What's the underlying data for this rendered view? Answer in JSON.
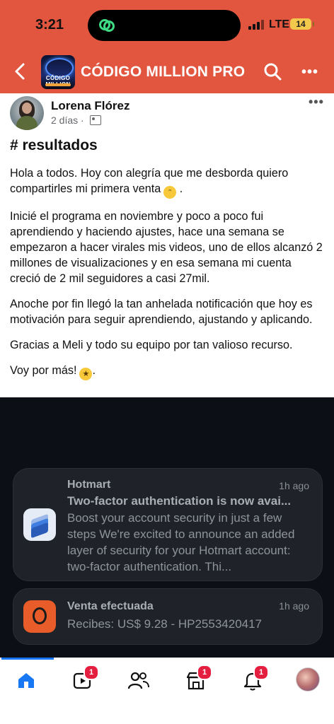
{
  "status": {
    "time": "3:21",
    "network": "LTE",
    "battery": "14"
  },
  "app_bar": {
    "title": "CÓDIGO MILLION PRO",
    "logo_text": "CÓDIGO MILLION"
  },
  "post": {
    "author": "Lorena Flórez",
    "time": "2 días",
    "separator": "·",
    "heading": "# resultados",
    "paragraphs": [
      "Hola a todos. Hoy con alegría que me desborda quiero compartirles mi primera venta",
      "Inicié el programa en noviembre y poco a poco fui aprendiendo y haciendo ajustes, hace una semana se empezaron a hacer virales mis videos, uno de ellos alcanzó 2 millones de visualizaciones y en esa semana mi cuenta creció de 2 mil seguidores a casi 27mil.",
      "Anoche por fin llegó la tan anhelada notificación que hoy es motivación para seguir aprendiendo, ajustando y aplicando.",
      "Gracias a Meli y todo su equipo por tan valioso recurso.",
      "Voy por más!"
    ],
    "emoji_end": "."
  },
  "notifications": [
    {
      "app": "Hotmart",
      "time": "1h ago",
      "title": "Two-factor authentication is now avai...",
      "body": "Boost your account security in just a few steps We're excited to announce an added layer of security for your Hotmart account: two-factor authentication. Thi..."
    },
    {
      "app": "Venta efectuada",
      "time": "1h ago",
      "body": "Recibes: US$ 9.28 - HP2553420417"
    }
  ],
  "tabbar": {
    "badges": {
      "video": "1",
      "marketplace": "1",
      "notifications": "1"
    }
  },
  "colors": {
    "brand": "#e2553f",
    "tab_active": "#1877f2",
    "badge": "#e41e3f"
  }
}
